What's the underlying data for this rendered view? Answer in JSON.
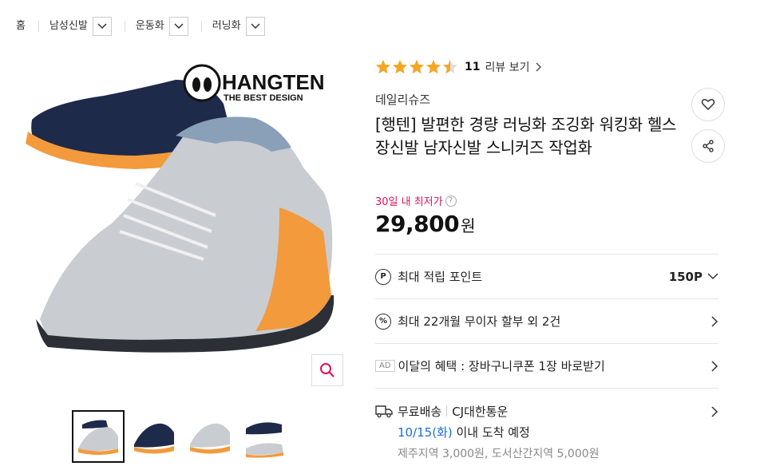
{
  "breadcrumb": {
    "items": [
      {
        "label": "홈",
        "has_dropdown": false
      },
      {
        "label": "남성신발",
        "has_dropdown": true
      },
      {
        "label": "운동화",
        "has_dropdown": true
      },
      {
        "label": "러닝화",
        "has_dropdown": true
      }
    ]
  },
  "gallery": {
    "logo_brand": "HANGTEN",
    "logo_tagline": "THE BEST DESIGN",
    "thumb_count": 4,
    "active_thumb": 0
  },
  "product": {
    "rating": 4.5,
    "review_count": "11",
    "review_link": "리뷰 보기",
    "brand": "데일리슈즈",
    "title": "[행텐] 발편한 경량 러닝화 조깅화 워킹화 헬스장신발 남자신발 스니커즈 작업화",
    "lowest_label": "30일 내 최저가",
    "help_glyph": "?",
    "price": "29,800",
    "price_unit": "원"
  },
  "rows": {
    "points": {
      "icon": "P",
      "label": "최대 적립 포인트",
      "value": "150P"
    },
    "installment": {
      "icon": "%",
      "label": "최대 22개월 무이자 할부 외 2건"
    },
    "benefit": {
      "badge": "AD",
      "label": "이달의 혜택 : 장바구니쿠폰 1장 바로받기"
    }
  },
  "shipping": {
    "label": "무료배송",
    "carrier": "CJ대한통운",
    "date": "10/15(화)",
    "date_suffix": " 이내 도착 예정",
    "extra_fee": "제주지역 3,000원, 도서산간지역 5,000원"
  },
  "colors": {
    "accent_pink": "#e0115f",
    "star": "#f5a623",
    "blue": "#1a6fd8"
  }
}
